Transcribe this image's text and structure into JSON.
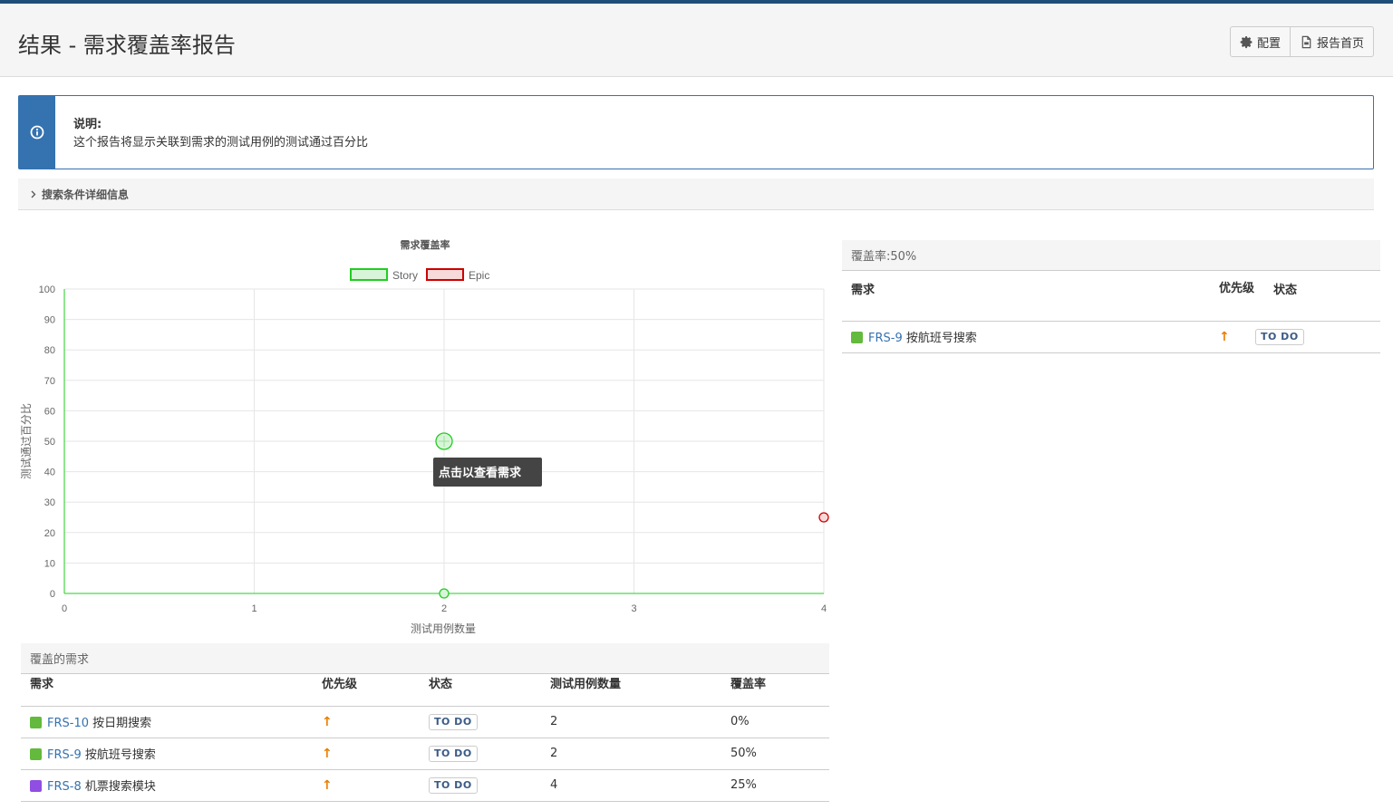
{
  "header": {
    "title": "结果 - 需求覆盖率报告",
    "config_label": "配置",
    "home_label": "报告首页"
  },
  "notice": {
    "title": "说明:",
    "text": "这个报告将显示关联到需求的测试用例的测试通过百分比"
  },
  "search": {
    "label": "搜索条件详细信息"
  },
  "chart_data": {
    "type": "scatter",
    "title": "需求覆盖率",
    "xlabel": "测试用例数量",
    "ylabel": "测试通过百分比",
    "xlim": [
      0,
      4
    ],
    "ylim": [
      0,
      100
    ],
    "x_ticks": [
      "0",
      "1",
      "2",
      "3",
      "4"
    ],
    "y_ticks": [
      "0",
      "10",
      "20",
      "30",
      "40",
      "50",
      "60",
      "70",
      "80",
      "90",
      "100"
    ],
    "grid": true,
    "legend": "top-center",
    "series": [
      {
        "name": "Story",
        "color": "#22cc22",
        "fill": "#d9f5d9",
        "points": [
          {
            "x": 2,
            "y": 0
          },
          {
            "x": 2,
            "y": 50
          }
        ]
      },
      {
        "name": "Epic",
        "color": "#cc0000",
        "fill": "#f7d9d9",
        "points": [
          {
            "x": 4,
            "y": 25
          }
        ]
      }
    ],
    "tooltip": "点击以查看需求"
  },
  "right_panel": {
    "title": "覆盖率:50%",
    "columns": [
      "需求",
      "优先级",
      "状态"
    ],
    "rows": [
      {
        "key": "FRS-9",
        "summary": "按航班号搜索",
        "type": "story",
        "priority": "↑",
        "status": "TO DO"
      }
    ]
  },
  "bottom_panel": {
    "title": "覆盖的需求",
    "columns": [
      "需求",
      "优先级",
      "状态",
      "测试用例数量",
      "覆盖率"
    ],
    "rows": [
      {
        "key": "FRS-10",
        "summary": "按日期搜索",
        "type": "story",
        "priority": "↑",
        "status": "TO DO",
        "count": "2",
        "coverage": "0%"
      },
      {
        "key": "FRS-9",
        "summary": "按航班号搜索",
        "type": "story",
        "priority": "↑",
        "status": "TO DO",
        "count": "2",
        "coverage": "50%"
      },
      {
        "key": "FRS-8",
        "summary": "机票搜索模块",
        "type": "epic",
        "priority": "↑",
        "status": "TO DO",
        "count": "4",
        "coverage": "25%"
      }
    ]
  }
}
